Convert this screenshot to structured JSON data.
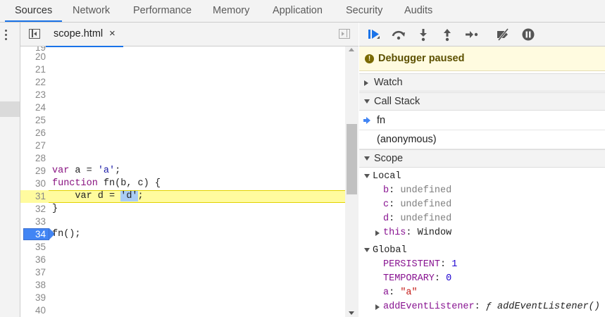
{
  "top_tabs": [
    {
      "label": "Sources",
      "active": true
    },
    {
      "label": "Network"
    },
    {
      "label": "Performance"
    },
    {
      "label": "Memory"
    },
    {
      "label": "Application"
    },
    {
      "label": "Security"
    },
    {
      "label": "Audits"
    }
  ],
  "editor": {
    "file_tab": {
      "name": "scope.html",
      "close": "×"
    },
    "lines": [
      {
        "n": "20",
        "code": ""
      },
      {
        "n": "21",
        "code": ""
      },
      {
        "n": "22",
        "code": ""
      },
      {
        "n": "23",
        "code": ""
      },
      {
        "n": "24",
        "code": ""
      },
      {
        "n": "25",
        "code": ""
      },
      {
        "n": "26",
        "code": ""
      },
      {
        "n": "27",
        "code": ""
      },
      {
        "n": "28",
        "code": ""
      },
      {
        "n": "29",
        "code": "var a = 'a';"
      },
      {
        "n": "30",
        "code": "function fn(b, c) {"
      },
      {
        "n": "31",
        "code": "    var d = 'd';"
      },
      {
        "n": "32",
        "code": "}"
      },
      {
        "n": "33",
        "code": ""
      },
      {
        "n": "34",
        "code": "fn();"
      },
      {
        "n": "35",
        "code": ""
      },
      {
        "n": "36",
        "code": ""
      },
      {
        "n": "37",
        "code": ""
      },
      {
        "n": "38",
        "code": ""
      },
      {
        "n": "39",
        "code": ""
      },
      {
        "n": "40",
        "code": ""
      }
    ],
    "execution_line": "31",
    "breakpoint_line": "34"
  },
  "debugger": {
    "status": "Debugger paused",
    "toolbar": [
      "resume-icon",
      "step-over-icon",
      "step-into-icon",
      "step-out-icon",
      "step-icon",
      "deactivate-breakpoints-icon",
      "pause-on-exceptions-icon"
    ],
    "sections": {
      "watch": "Watch",
      "call_stack": "Call Stack",
      "scope": "Scope"
    },
    "call_stack": [
      {
        "label": "fn",
        "current": true
      },
      {
        "label": "(anonymous)",
        "current": false
      }
    ],
    "scope": {
      "local": {
        "label": "Local",
        "vars": [
          {
            "key": "b",
            "value": "undefined"
          },
          {
            "key": "c",
            "value": "undefined"
          },
          {
            "key": "d",
            "value": "undefined"
          }
        ],
        "this": {
          "key": "this",
          "value": "Window"
        }
      },
      "global": {
        "label": "Global",
        "vars": [
          {
            "key": "PERSISTENT",
            "value": "1"
          },
          {
            "key": "TEMPORARY",
            "value": "0"
          },
          {
            "key": "a",
            "value": "\"a\""
          }
        ],
        "fn_entry": {
          "key": "addEventListener",
          "f": "ƒ",
          "value": "addEventListener()"
        }
      }
    }
  },
  "colors": {
    "accent": "#1a73e8",
    "exec_line": "#fffb9f",
    "breakpoint": "#4285f4",
    "paused_bg": "#fffbe0"
  }
}
